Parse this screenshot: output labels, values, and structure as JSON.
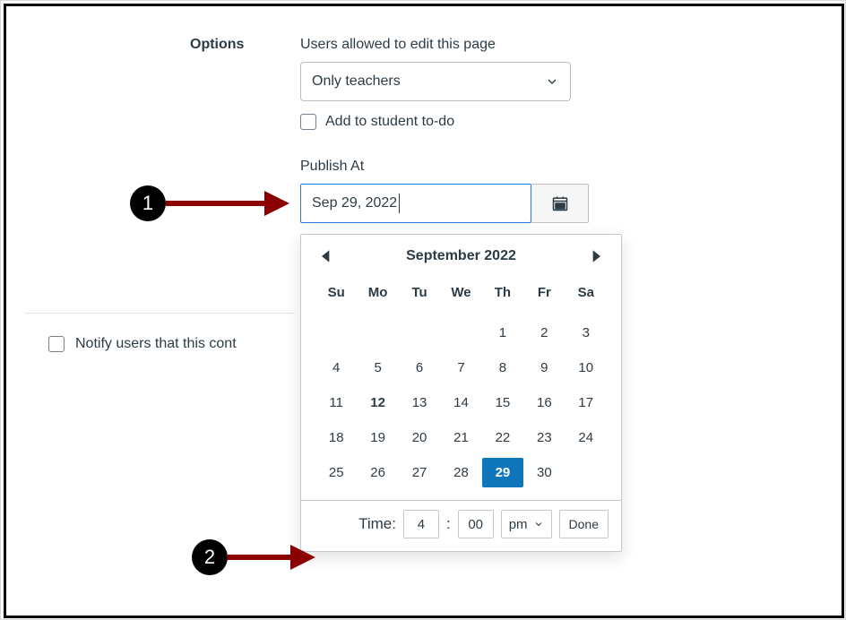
{
  "options": {
    "section_label": "Options",
    "users_allowed_label": "Users allowed to edit this page",
    "users_allowed_value": "Only teachers",
    "todo_label": "Add to student to-do",
    "publish_label": "Publish At",
    "publish_value": "Sep 29, 2022"
  },
  "notify": {
    "label": "Notify users that this cont"
  },
  "datepicker": {
    "month_title": "September 2022",
    "day_names": [
      "Su",
      "Mo",
      "Tu",
      "We",
      "Th",
      "Fr",
      "Sa"
    ],
    "leading_blanks": 4,
    "days_in_month": 30,
    "today": 12,
    "selected": 29,
    "time": {
      "label": "Time:",
      "hour": "4",
      "minute": "00",
      "ampm": "pm",
      "done_label": "Done"
    }
  },
  "annotations": {
    "badge1": "1",
    "badge2": "2"
  }
}
